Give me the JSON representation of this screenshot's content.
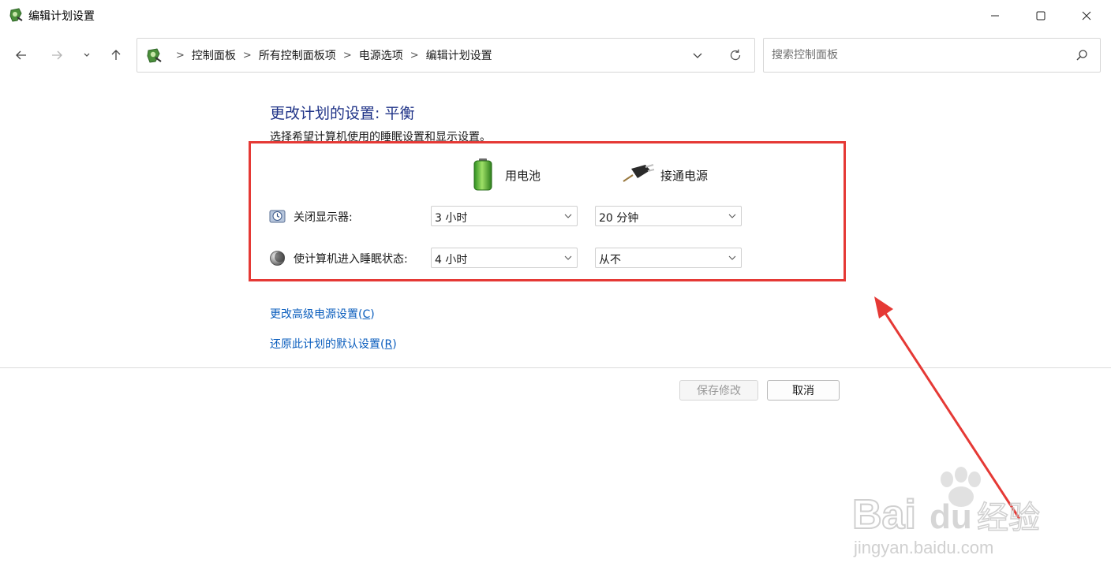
{
  "window": {
    "title": "编辑计划设置"
  },
  "nav": {
    "breadcrumbs": [
      "控制面板",
      "所有控制面板项",
      "电源选项",
      "编辑计划设置"
    ]
  },
  "search": {
    "placeholder": "搜索控制面板"
  },
  "content": {
    "title": "更改计划的设置: 平衡",
    "subtitle": "选择希望计算机使用的睡眠设置和显示设置。",
    "columns": {
      "battery": "用电池",
      "plugged_in": "接通电源"
    },
    "rows": {
      "display_off": {
        "label": "关闭显示器:",
        "battery_value": "3 小时",
        "plugged_value": "20 分钟"
      },
      "sleep": {
        "label": "使计算机进入睡眠状态:",
        "battery_value": "4 小时",
        "plugged_value": "从不"
      }
    },
    "links": {
      "advanced_prefix": "更改高级电源设置(",
      "advanced_key": "C",
      "advanced_suffix": ")",
      "restore_prefix": "还原此计划的默认设置(",
      "restore_key": "R",
      "restore_suffix": ")"
    },
    "buttons": {
      "save": "保存修改",
      "cancel": "取消"
    }
  },
  "watermark": {
    "line1": "Bai",
    "line1b": "du",
    "line1c": "经验",
    "line2": "jingyan.baidu.com"
  },
  "colors": {
    "title_blue": "#1e3287",
    "link_blue": "#0a5dbd",
    "highlight_red": "#e53935"
  },
  "icons": {
    "app": "power-options-icon",
    "battery": "battery-icon",
    "plug": "power-plug-icon",
    "display": "display-clock-icon",
    "sleep": "moon-sleep-icon"
  }
}
